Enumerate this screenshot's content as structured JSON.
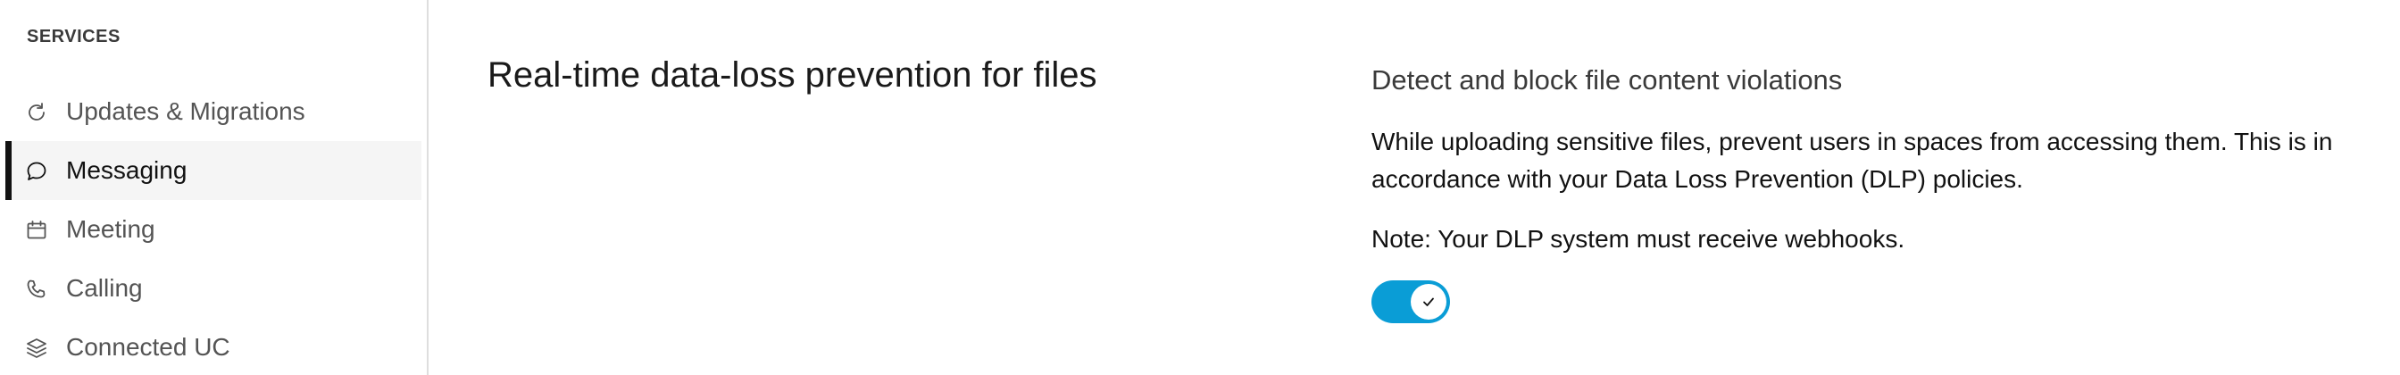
{
  "sidebar": {
    "section_label": "SERVICES",
    "items": [
      {
        "label": "Updates & Migrations",
        "icon": "refresh-icon",
        "active": false
      },
      {
        "label": "Messaging",
        "icon": "chat-bubble-icon",
        "active": true
      },
      {
        "label": "Meeting",
        "icon": "calendar-icon",
        "active": false
      },
      {
        "label": "Calling",
        "icon": "phone-icon",
        "active": false
      },
      {
        "label": "Connected UC",
        "icon": "layers-icon",
        "active": false
      }
    ]
  },
  "main": {
    "setting_title": "Real-time data-loss prevention for files",
    "heading": "Detect and block file content violations",
    "description": "While uploading sensitive files, prevent users in spaces from accessing them. This is in accordance with your Data Loss Prevention (DLP) policies.",
    "note": "Note: Your DLP system must receive webhooks.",
    "toggle": {
      "on": true,
      "icon": "checkmark-icon"
    }
  },
  "colors": {
    "accent": "#0a9dd6",
    "active_indicator": "#121212",
    "active_bg": "#f5f5f5",
    "divider": "#dedede"
  }
}
